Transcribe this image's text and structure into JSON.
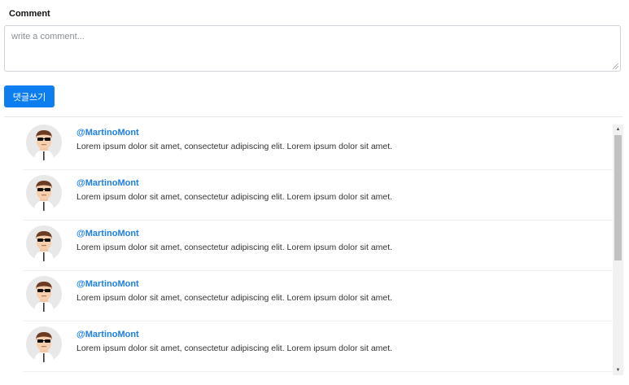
{
  "form": {
    "label": "Comment",
    "placeholder": "write a comment...",
    "submit_label": "댓글쓰기"
  },
  "comments": [
    {
      "username": "@MartinoMont",
      "text": "Lorem ipsum dolor sit amet, consectetur adipiscing elit. Lorem ipsum dolor sit amet."
    },
    {
      "username": "@MartinoMont",
      "text": "Lorem ipsum dolor sit amet, consectetur adipiscing elit. Lorem ipsum dolor sit amet."
    },
    {
      "username": "@MartinoMont",
      "text": "Lorem ipsum dolor sit amet, consectetur adipiscing elit. Lorem ipsum dolor sit amet."
    },
    {
      "username": "@MartinoMont",
      "text": "Lorem ipsum dolor sit amet, consectetur adipiscing elit. Lorem ipsum dolor sit amet."
    },
    {
      "username": "@MartinoMont",
      "text": "Lorem ipsum dolor sit amet, consectetur adipiscing elit. Lorem ipsum dolor sit amet."
    }
  ],
  "icons": {
    "avatar": "man-with-sunglasses-avatar",
    "scroll_up": "triangle-up-icon",
    "scroll_down": "triangle-down-icon"
  },
  "colors": {
    "accent": "#0d7ef0",
    "username": "#1c7fe6"
  }
}
